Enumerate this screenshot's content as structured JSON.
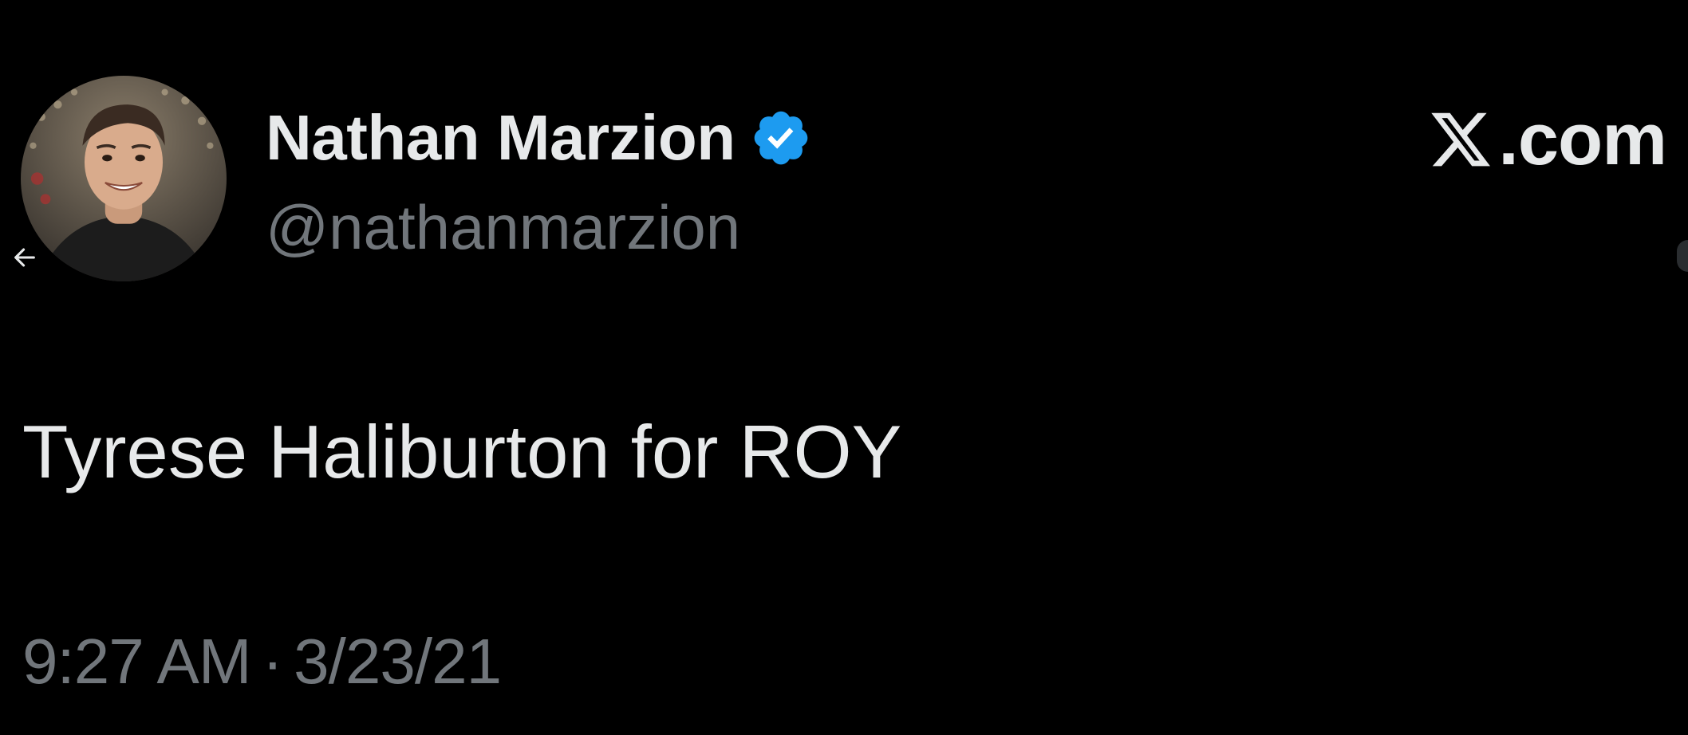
{
  "tweet": {
    "author": {
      "display_name": "Nathan Marzion",
      "handle": "@nathanmarzion",
      "verified": true,
      "verified_badge_icon": "verified-badge-icon",
      "verified_color": "#1d9bf0",
      "avatar_icon": "profile-photo"
    },
    "text": "Tyrese Haliburton for ROY",
    "time": "9:27 AM",
    "separator": "·",
    "date": "3/23/21"
  },
  "brand": {
    "icon": "x-logo-icon",
    "text": ".com"
  },
  "navigation": {
    "back_icon": "arrow-left-icon"
  },
  "colors": {
    "background": "#000000",
    "primary_text": "#e7e9ea",
    "secondary_text": "#71767b",
    "accent": "#1d9bf0"
  }
}
